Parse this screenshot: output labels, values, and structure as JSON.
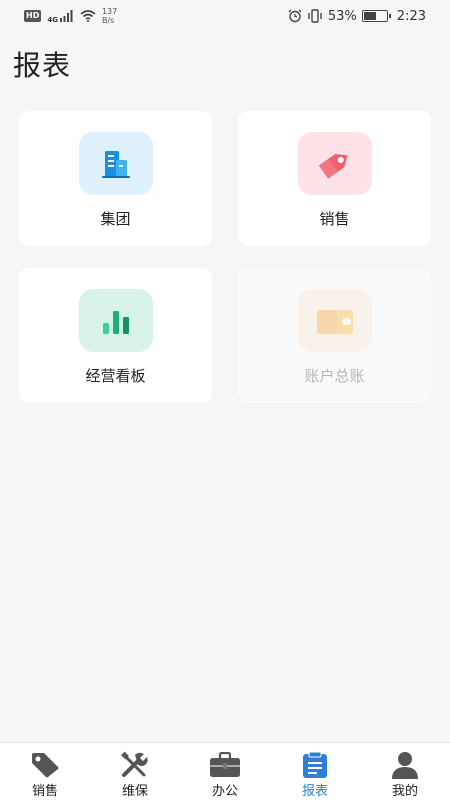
{
  "status_bar": {
    "hd": "HD",
    "network": "4G",
    "speed_value": "137",
    "speed_unit": "B/s",
    "battery_percent": "53%",
    "time": "2:23"
  },
  "page": {
    "title": "报表"
  },
  "cards": [
    {
      "label": "集团",
      "icon": "building-icon",
      "bg": "#dff1fd",
      "enabled": true
    },
    {
      "label": "销售",
      "icon": "price-tag-icon",
      "bg": "#fde3e8",
      "enabled": true
    },
    {
      "label": "经营看板",
      "icon": "bar-chart-icon",
      "bg": "#d9f3e8",
      "enabled": true
    },
    {
      "label": "账户总账",
      "icon": "wallet-card-icon",
      "bg": "#fdefdf",
      "enabled": false
    }
  ],
  "bottom_nav": [
    {
      "label": "销售",
      "icon": "tag-icon",
      "active": false
    },
    {
      "label": "维保",
      "icon": "tools-icon",
      "active": false
    },
    {
      "label": "办公",
      "icon": "briefcase-icon",
      "active": false
    },
    {
      "label": "报表",
      "icon": "clipboard-icon",
      "active": true
    },
    {
      "label": "我的",
      "icon": "person-icon",
      "active": false
    }
  ],
  "colors": {
    "accent": "#2f7fd8",
    "background": "#f6f6f6"
  }
}
